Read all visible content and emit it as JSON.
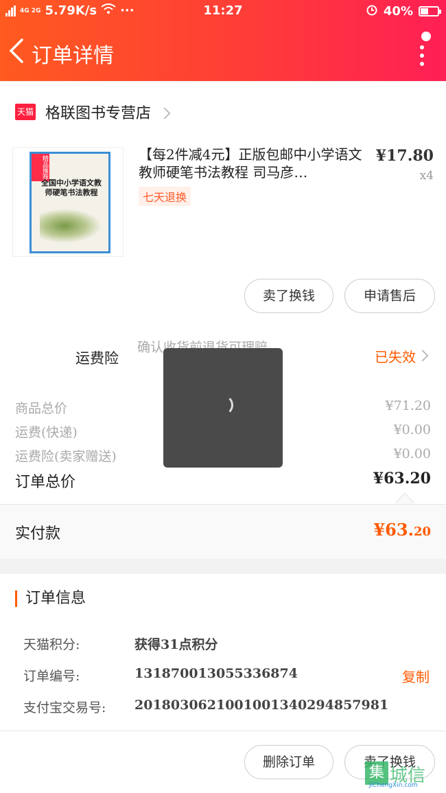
{
  "status_bar": {
    "network": "4G 2G",
    "speed": "5.79K/s",
    "dots": "···",
    "time": "11:27",
    "battery": "40%"
  },
  "header": {
    "title": "订单详情"
  },
  "store": {
    "badge": "天猫",
    "name": "格联图书专营店"
  },
  "product": {
    "cover_tag": "精品推荐",
    "cover_title": "全国中小学语文教师硬笔书法教程",
    "title": "【每2件减4元】正版包邮中小学语文教师硬笔书法教程 司马彦…",
    "price": "¥17.80",
    "quantity": "x4",
    "badge": "七天退换",
    "actions": [
      "卖了换钱",
      "申请售后"
    ]
  },
  "freight": {
    "label": "运费险",
    "desc": "确认收货前退货可理赔",
    "status": "已失效"
  },
  "summary": {
    "rows": [
      {
        "label": "商品总价",
        "value": "¥71.20"
      },
      {
        "label": "运费(快递)",
        "value": "¥0.00"
      },
      {
        "label": "运费险(卖家赠送)",
        "value": "¥0.00"
      }
    ],
    "total_label": "订单总价",
    "total_value": "¥63.20",
    "paid_label": "实付款",
    "paid_value_int": "¥63.",
    "paid_value_dec": "20"
  },
  "order_info": {
    "heading": "订单信息",
    "rows": [
      {
        "label": "天猫积分:",
        "value": "获得31点积分"
      },
      {
        "label": "订单编号:",
        "value": "1318700130553368​74",
        "action": "复制"
      },
      {
        "label": "支付宝交易号:",
        "value": "2018030621001001340294857981"
      }
    ]
  },
  "footer": {
    "actions": [
      "删除订单",
      "卖了换钱"
    ]
  },
  "watermark": {
    "cn": "城信",
    "badge": "集",
    "en": "JiChengXin.com"
  },
  "colors": {
    "accent": "#ff5a00",
    "header_start": "#ff5a1f",
    "header_end": "#ff1f55"
  }
}
